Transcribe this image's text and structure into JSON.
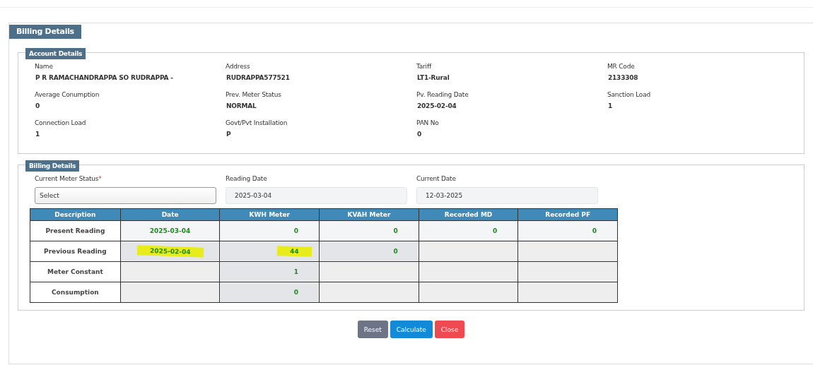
{
  "panel_title": "Billing Details",
  "account_details": {
    "title": "Account Details",
    "fields": [
      {
        "label": "Name",
        "value": "P R RAMACHANDRAPPA SO RUDRAPPA -"
      },
      {
        "label": "Address",
        "value": "RUDRAPPA577521"
      },
      {
        "label": "Tariff",
        "value": "LT1-Rural"
      },
      {
        "label": "MR Code",
        "value": "2133308"
      },
      {
        "label": "Average Conumption",
        "value": "0"
      },
      {
        "label": "Prev. Meter Status",
        "value": "NORMAL"
      },
      {
        "label": "Pv. Reading Date",
        "value": "2025-02-04"
      },
      {
        "label": "Sanction Load",
        "value": "1"
      },
      {
        "label": "Connection Load",
        "value": "1"
      },
      {
        "label": "Govt/Pvt Installation",
        "value": "P"
      },
      {
        "label": "PAN No",
        "value": "0"
      }
    ]
  },
  "billing_details": {
    "title": "Billing Details",
    "inputs": [
      {
        "kind": "select",
        "label": "Current Meter Status",
        "required_mark": "*",
        "value": "Select"
      },
      {
        "kind": "readonly",
        "label": "Reading Date",
        "value": "2025-03-04"
      },
      {
        "kind": "readonly",
        "label": "Current Date",
        "value": "12-03-2025"
      }
    ],
    "table": {
      "columns": [
        "Description",
        "Date",
        "KWH Meter",
        "KVAH Meter",
        "Recorded MD",
        "Recorded PF"
      ],
      "rows": [
        {
          "cells": [
            {
              "kind": "label",
              "value": "Present Reading"
            },
            {
              "kind": "input",
              "value": "2025-03-04",
              "highlighted": false
            },
            {
              "kind": "input",
              "value": "0",
              "highlighted": false
            },
            {
              "kind": "input",
              "value": "0",
              "highlighted": false
            },
            {
              "kind": "input",
              "value": "0",
              "highlighted": false
            },
            {
              "kind": "input",
              "value": "0",
              "highlighted": false
            }
          ]
        },
        {
          "cells": [
            {
              "kind": "label",
              "value": "Previous Reading"
            },
            {
              "kind": "display",
              "value": "2025-02-04",
              "highlighted": true
            },
            {
              "kind": "display",
              "value": "44",
              "highlighted": true
            },
            {
              "kind": "display",
              "value": "0",
              "highlighted": false
            },
            {
              "kind": "empty"
            },
            {
              "kind": "empty"
            }
          ]
        },
        {
          "cells": [
            {
              "kind": "label",
              "value": "Meter Constant"
            },
            {
              "kind": "empty"
            },
            {
              "kind": "display",
              "value": "1",
              "highlighted": false
            },
            {
              "kind": "empty"
            },
            {
              "kind": "empty"
            },
            {
              "kind": "empty"
            }
          ]
        },
        {
          "cells": [
            {
              "kind": "label",
              "value": "Consumption"
            },
            {
              "kind": "empty"
            },
            {
              "kind": "display",
              "value": "0",
              "highlighted": false
            },
            {
              "kind": "empty"
            },
            {
              "kind": "empty"
            },
            {
              "kind": "empty"
            }
          ]
        }
      ]
    }
  },
  "buttons": [
    {
      "label": "Reset",
      "color": "#6c7485"
    },
    {
      "label": "Calculate",
      "color": "#138ad8"
    },
    {
      "label": "Close",
      "color": "#ef4a52"
    }
  ]
}
